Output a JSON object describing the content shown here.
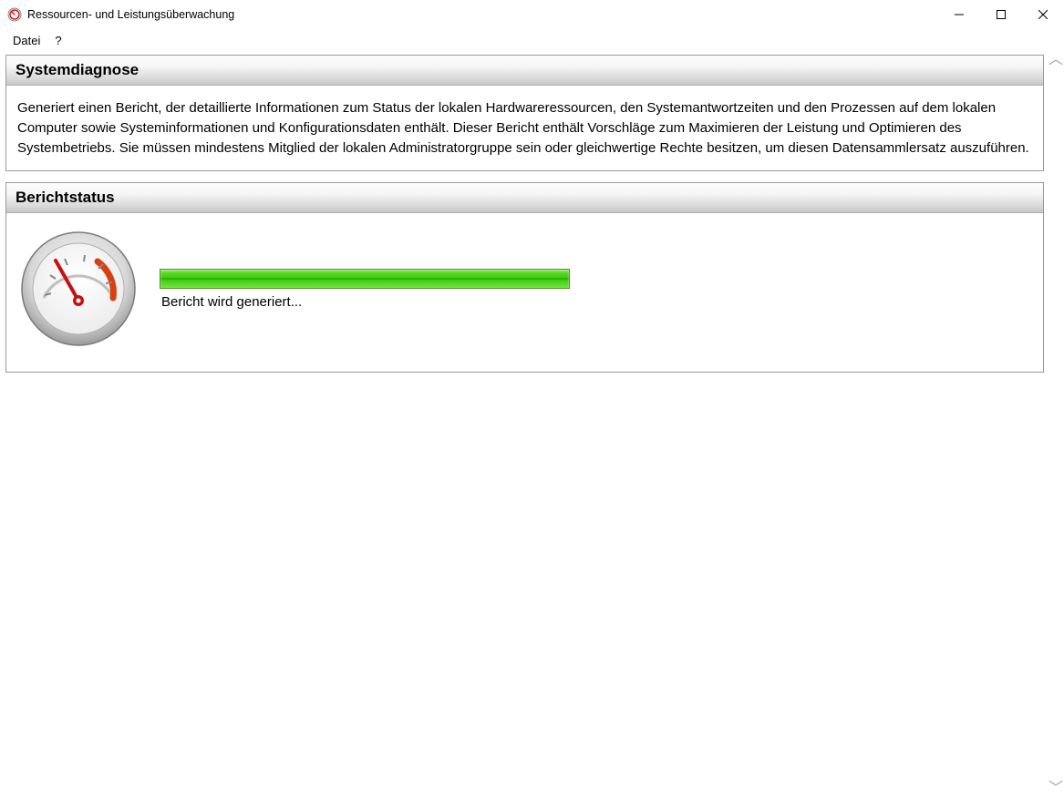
{
  "window": {
    "title": "Ressourcen- und Leistungsüberwachung"
  },
  "menu": {
    "file": "Datei",
    "help": "?"
  },
  "panels": {
    "diagnosis": {
      "title": "Systemdiagnose",
      "body": "Generiert einen Bericht, der detaillierte Informationen zum Status der lokalen Hardwareressourcen, den Systemantwortzeiten und den Prozessen auf dem lokalen Computer sowie Systeminformationen und Konfigurationsdaten enthält. Dieser Bericht enthält Vorschläge zum Maximieren der Leistung und Optimieren des Systembetriebs. Sie müssen mindestens Mitglied der lokalen Administratorgruppe sein oder gleichwertige Rechte besitzen, um diesen Datensammlersatz auszuführen."
    },
    "status": {
      "title": "Berichtstatus",
      "message": "Bericht wird generiert..."
    }
  }
}
